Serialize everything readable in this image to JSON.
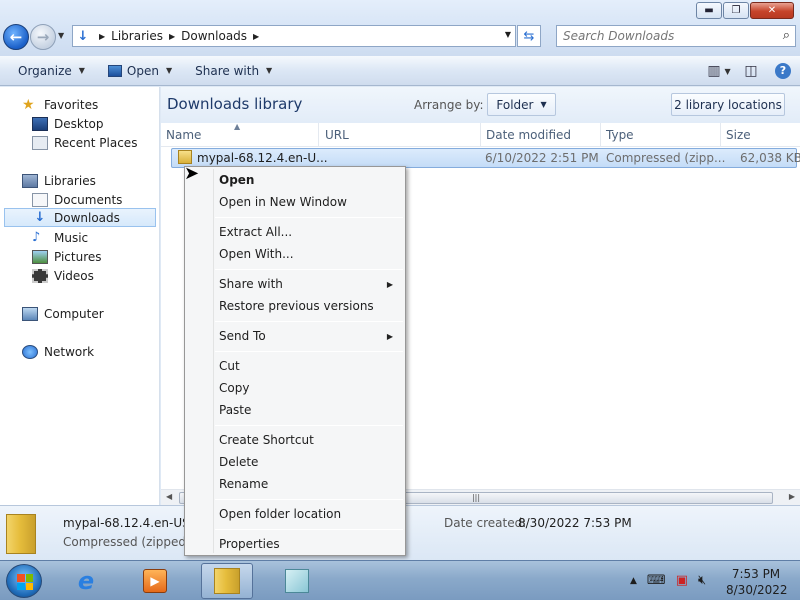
{
  "window": {
    "minimize_glyph": "▬",
    "maximize_glyph": "❐",
    "close_glyph": "✕"
  },
  "nav": {
    "back_icon": "back-arrow-icon",
    "breadcrumb": [
      "Libraries",
      "Downloads"
    ],
    "search_placeholder": "Search Downloads"
  },
  "toolbar": {
    "organize": "Organize",
    "open": "Open",
    "share_with": "Share with"
  },
  "sidebar": {
    "favorites": "Favorites",
    "desktop": "Desktop",
    "recent_places": "Recent Places",
    "libraries": "Libraries",
    "documents": "Documents",
    "downloads": "Downloads",
    "music": "Music",
    "pictures": "Pictures",
    "videos": "Videos",
    "computer": "Computer",
    "network": "Network"
  },
  "library": {
    "title": "Downloads library",
    "arrange_label": "Arrange by:",
    "arrange_value": "Folder",
    "locations": "2 library locations"
  },
  "columns": {
    "name": "Name",
    "url": "URL",
    "date_modified": "Date modified",
    "type": "Type",
    "size": "Size"
  },
  "file": {
    "name": "mypal-68.12.4.en-U...",
    "date_modified": "6/10/2022 2:51 PM",
    "type": "Compressed (zipp...",
    "size": "62,038 KB"
  },
  "details": {
    "name": "mypal-68.12.4.en-US.",
    "type": "Compressed (zipped) F",
    "created_label": "Date created:",
    "created_value": "8/30/2022 7:53 PM"
  },
  "context_menu": {
    "open": "Open",
    "open_new_window": "Open in New Window",
    "extract_all": "Extract All...",
    "open_with": "Open With...",
    "share_with": "Share with",
    "restore": "Restore previous versions",
    "send_to": "Send To",
    "cut": "Cut",
    "copy": "Copy",
    "paste": "Paste",
    "create_shortcut": "Create Shortcut",
    "delete": "Delete",
    "rename": "Rename",
    "open_folder_location": "Open folder location",
    "properties": "Properties"
  },
  "taskbar": {
    "time": "7:53 PM",
    "date": "8/30/2022"
  },
  "colors": {
    "selection": "#c4dcf7",
    "accent": "#1a5fc8"
  }
}
